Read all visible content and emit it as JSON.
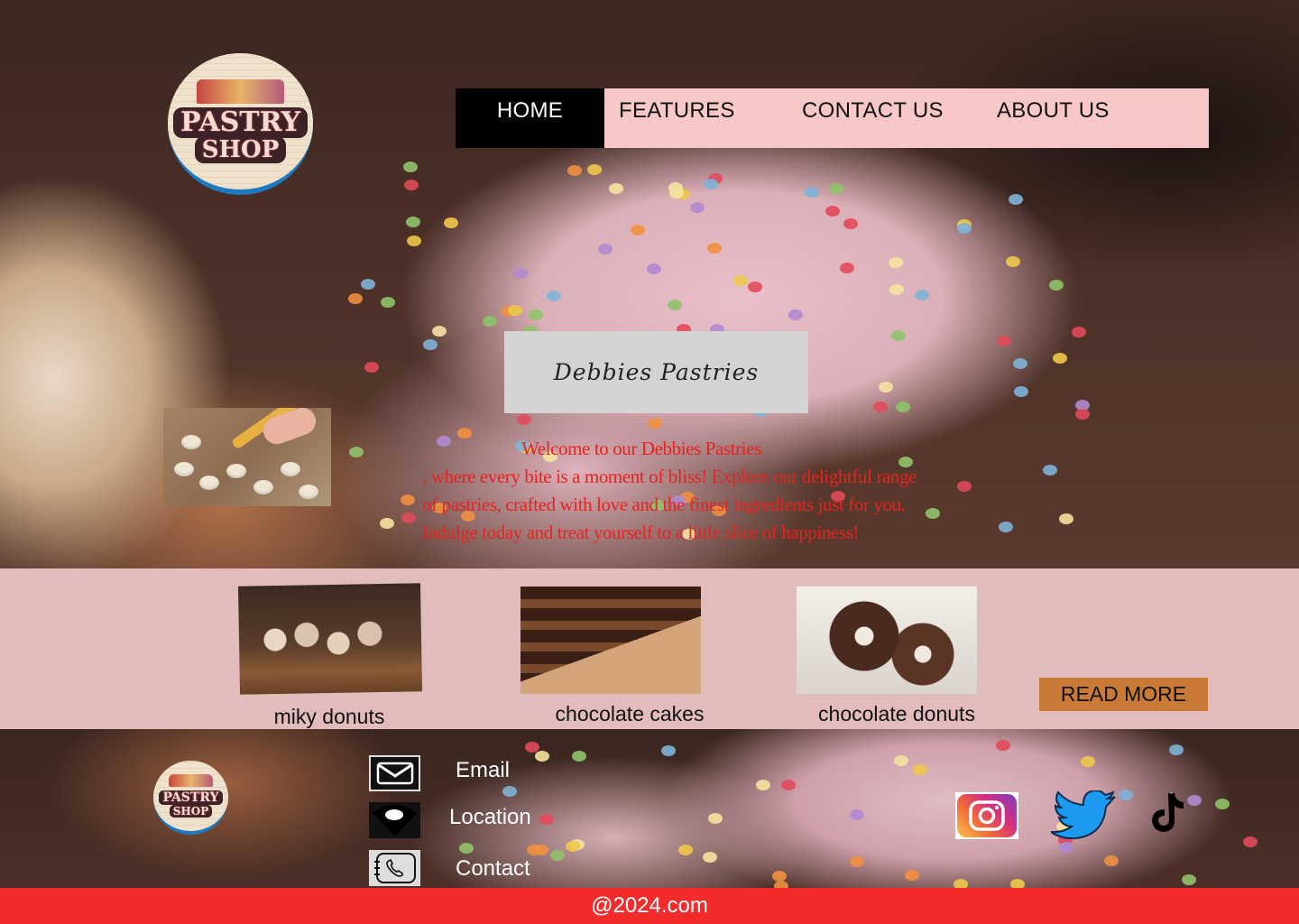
{
  "brand": {
    "logo_text_line1": "PASTRY",
    "logo_text_line2": "SHOP"
  },
  "nav": {
    "items": [
      {
        "label": "HOME",
        "active": true
      },
      {
        "label": "FEATURES",
        "active": false
      },
      {
        "label": "CONTACT US",
        "active": false
      },
      {
        "label": "ABOUT US",
        "active": false
      }
    ]
  },
  "hero": {
    "title": "Debbies Pastries",
    "welcome_lines": [
      "Welcome to our Debbies Pastries",
      ", where every bite is a moment of bliss! Explore our delightful range",
      "of pastries, crafted with love and the finest ingredients just for you.",
      "Indulge today and treat yourself to a little slice of happiness!"
    ]
  },
  "products": [
    {
      "caption": "miky donuts"
    },
    {
      "caption": "chocolate cakes"
    },
    {
      "caption": "chocolate donuts"
    }
  ],
  "read_more_label": "READ MORE",
  "footer": {
    "contacts": [
      {
        "label": "Email",
        "icon": "mail-icon"
      },
      {
        "label": "Location",
        "icon": "location-icon"
      },
      {
        "label": "Contact",
        "icon": "phone-icon"
      }
    ],
    "socials": [
      "instagram-icon",
      "twitter-icon",
      "tiktok-icon"
    ],
    "copyright": "@2024.com"
  },
  "colors": {
    "nav_bg": "#f8c8c8",
    "nav_active": "#000000",
    "strip_bg": "#e2bcbd",
    "read_more_bg": "#c97a36",
    "welcome_text": "#e8221d",
    "bottom_bar": "#f42b2b"
  }
}
